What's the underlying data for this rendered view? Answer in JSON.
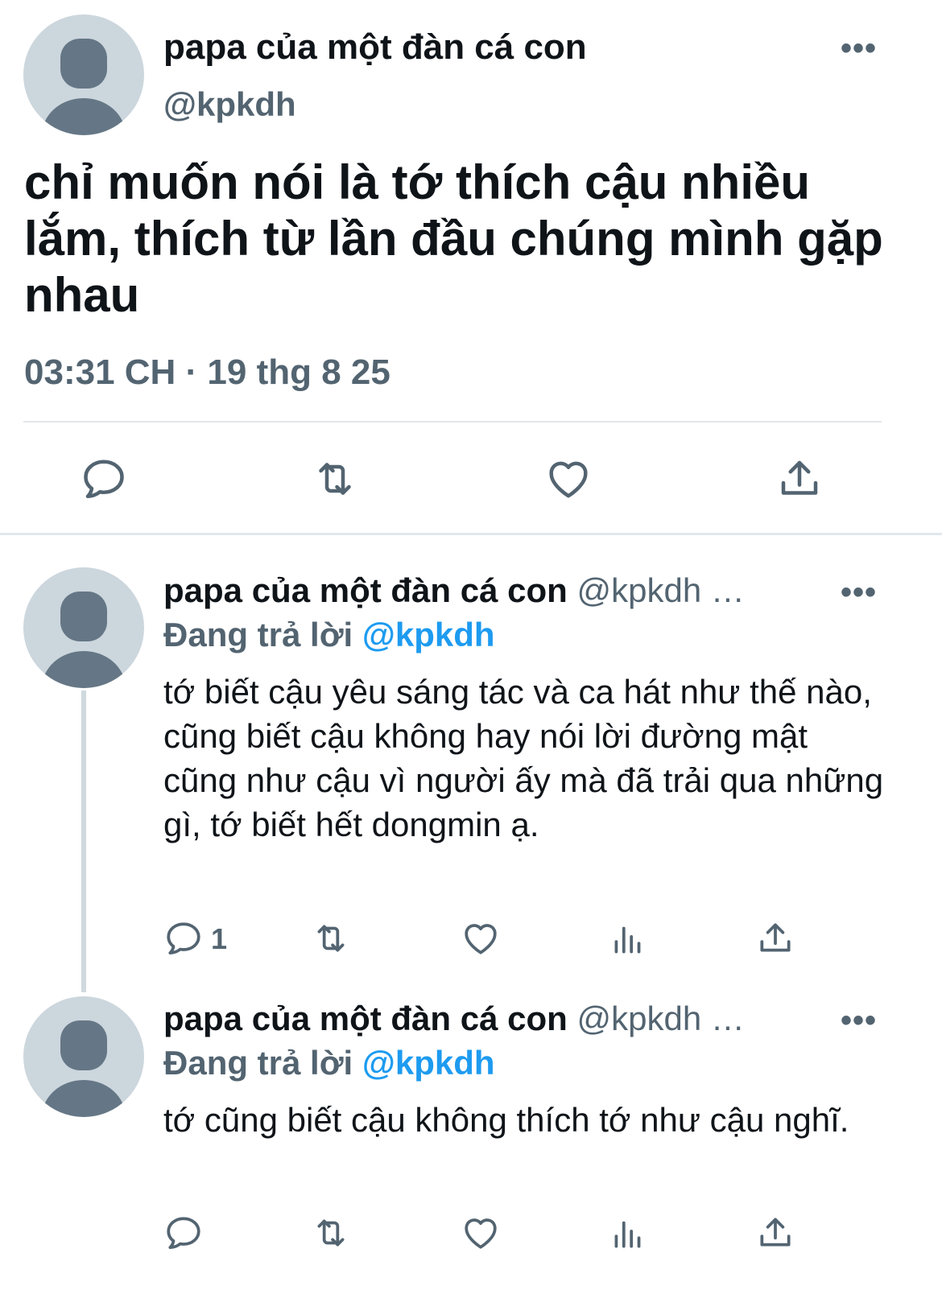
{
  "colors": {
    "text_primary": "#0f1419",
    "text_secondary": "#536471",
    "mention": "#1d9bf0",
    "avatar_bg": "#ccd6dd",
    "avatar_figure": "#657786",
    "divider": "#e1e8ed"
  },
  "main_tweet": {
    "author_name": "papa của một đàn cá con",
    "handle": "@kpkdh",
    "more_icon": "more-dots-icon",
    "text": "chỉ muốn nói là tớ thích cậu nhiều lắm, thích từ lần đầu chúng mình gặp nhau",
    "timestamp": "03:31 CH · 19 thg 8 25",
    "actions": [
      "reply-icon",
      "retweet-icon",
      "like-icon",
      "share-icon"
    ]
  },
  "replies": [
    {
      "author_name": "papa của một đàn cá con",
      "handle": "@kpkdh …",
      "replying_prefix": "Đang trả lời",
      "replying_to": "@kpkdh",
      "text": "tớ biết cậu yêu sáng tác và ca hát như thế nào, cũng biết cậu không hay nói lời đường mật cũng như cậu vì người ấy mà đã trải qua những gì, tớ biết hết dongmin ạ.",
      "reply_count": "1",
      "actions": [
        "reply-icon",
        "retweet-icon",
        "like-icon",
        "views-icon",
        "share-icon"
      ]
    },
    {
      "author_name": "papa của một đàn cá con",
      "handle": "@kpkdh …",
      "replying_prefix": "Đang trả lời",
      "replying_to": "@kpkdh",
      "text": "tớ cũng biết cậu không thích tớ như cậu nghĩ.",
      "reply_count": "",
      "actions": [
        "reply-icon",
        "retweet-icon",
        "like-icon",
        "views-icon",
        "share-icon"
      ]
    }
  ]
}
